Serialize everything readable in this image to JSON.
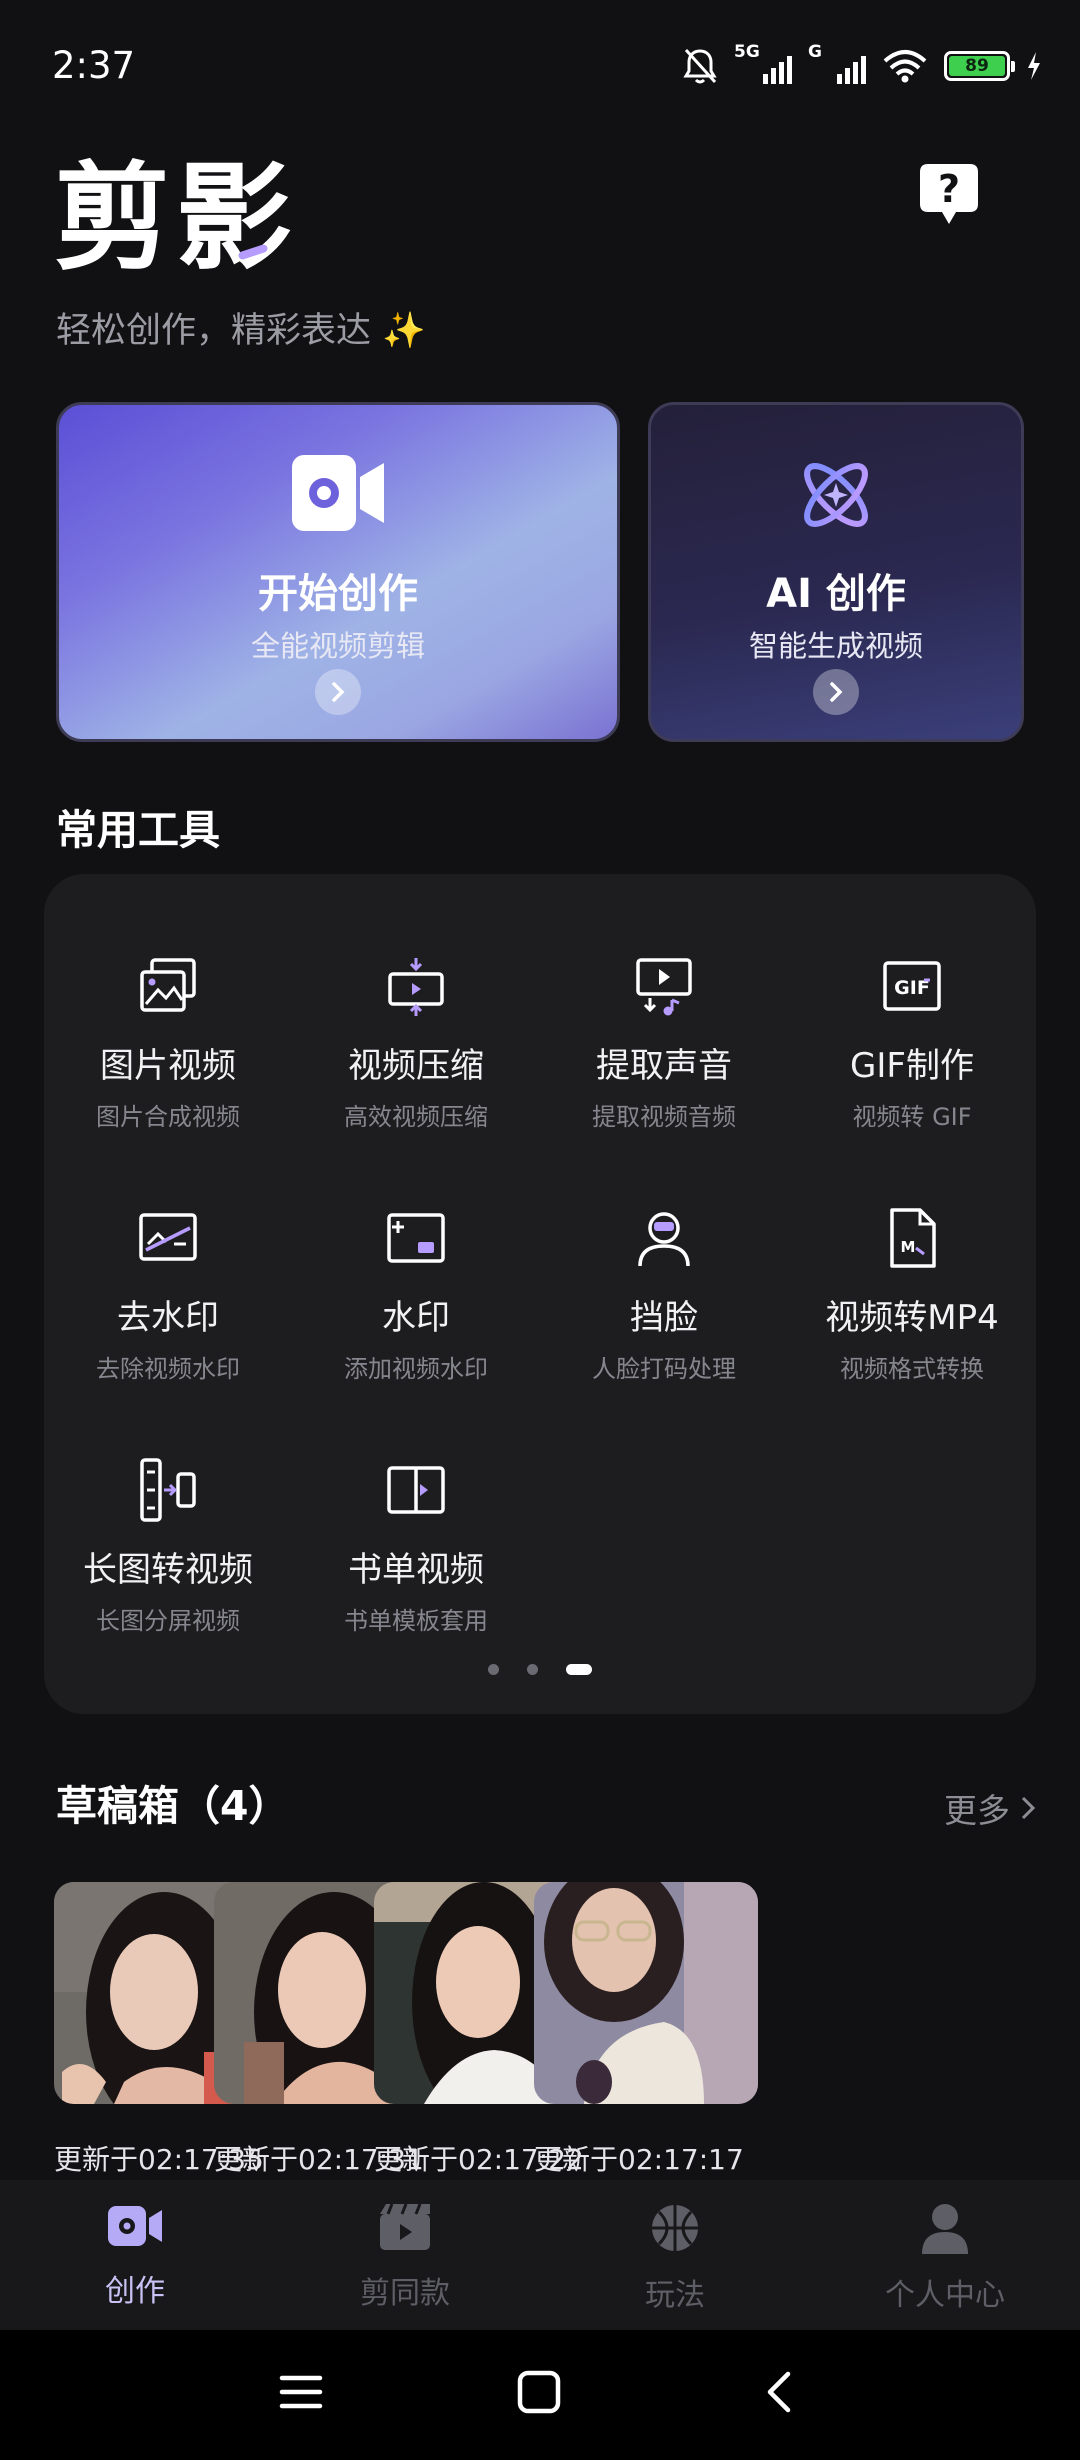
{
  "status_bar": {
    "time": "2:37",
    "network_1": "5G",
    "network_2": "G",
    "battery": "89",
    "icons": [
      "mute-icon",
      "signal-icon",
      "wifi-icon",
      "battery-icon",
      "charging-icon"
    ]
  },
  "header": {
    "logo": "剪影",
    "slogan": "轻松创作，精彩表达 ✨",
    "help_icon": "help-icon"
  },
  "hero_cards": [
    {
      "title": "开始创作",
      "subtitle": "全能视频剪辑",
      "icon": "video-camera-icon"
    },
    {
      "title": "AI 创作",
      "subtitle": "智能生成视频",
      "icon": "ai-atom-icon"
    }
  ],
  "tools": {
    "section_title": "常用工具",
    "items": [
      {
        "name": "图片视频",
        "desc": "图片合成视频",
        "icon": "image-video-icon"
      },
      {
        "name": "视频压缩",
        "desc": "高效视频压缩",
        "icon": "compress-icon"
      },
      {
        "name": "提取声音",
        "desc": "提取视频音频",
        "icon": "extract-audio-icon"
      },
      {
        "name": "GIF制作",
        "desc": "视频转 GIF",
        "icon": "gif-icon"
      },
      {
        "name": "去水印",
        "desc": "去除视频水印",
        "icon": "remove-watermark-icon"
      },
      {
        "name": "水印",
        "desc": "添加视频水印",
        "icon": "watermark-icon"
      },
      {
        "name": "挡脸",
        "desc": "人脸打码处理",
        "icon": "face-mask-icon"
      },
      {
        "name": "视频转MP4",
        "desc": "视频格式转换",
        "icon": "mp4-icon"
      },
      {
        "name": "长图转视频",
        "desc": "长图分屏视频",
        "icon": "long-image-icon"
      },
      {
        "name": "书单视频",
        "desc": "书单模板套用",
        "icon": "book-video-icon"
      }
    ],
    "page_count": 3,
    "current_page": 3
  },
  "drafts": {
    "section_title": "草稿箱（4）",
    "more_label": "更多",
    "items": [
      {
        "time": "更新于02:17:35"
      },
      {
        "time": "更新于02:17:31"
      },
      {
        "time": "更新于02:17:22"
      },
      {
        "time": "更新于02:17:17"
      }
    ]
  },
  "bottom_nav": {
    "items": [
      {
        "label": "创作",
        "icon": "create-icon",
        "active": true
      },
      {
        "label": "剪同款",
        "icon": "template-icon",
        "active": false
      },
      {
        "label": "玩法",
        "icon": "play-icon",
        "active": false
      },
      {
        "label": "个人中心",
        "icon": "profile-icon",
        "active": false
      }
    ]
  },
  "system_nav": [
    "menu-icon",
    "home-icon",
    "back-icon"
  ],
  "colors": {
    "background": "#111114",
    "panel": "#1d1d20",
    "accent": "#b69cff",
    "battery": "#3ecf4f"
  }
}
